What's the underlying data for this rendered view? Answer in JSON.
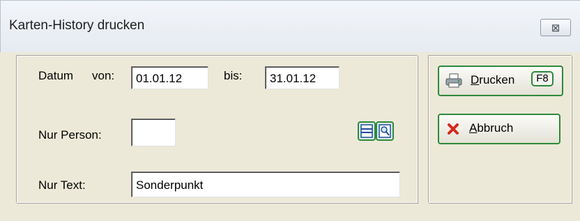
{
  "window": {
    "title": "Karten-History drucken",
    "close_glyph": "⊠"
  },
  "form": {
    "datum_label": "Datum",
    "von_label": "von:",
    "von_value": "01.01.12",
    "bis_label": "bis:",
    "bis_value": "31.01.12",
    "person_label": "Nur Person:",
    "person_value": "",
    "text_label": "Nur Text:",
    "text_value": "Sonderpunkt"
  },
  "buttons": {
    "print_underlined": "D",
    "print_rest": "rucken",
    "print_shortcut": "F8",
    "cancel_underlined": "A",
    "cancel_rest": "bbruch"
  },
  "icons": {
    "print": "printer-icon",
    "cancel": "red-x-icon",
    "person_list": "list-lookup-icon",
    "person_search": "magnifier-search-icon"
  },
  "colors": {
    "button_border": "#2d8a3a",
    "dialog_background": "#ece9d8",
    "cancel_x": "#d42a1e"
  }
}
